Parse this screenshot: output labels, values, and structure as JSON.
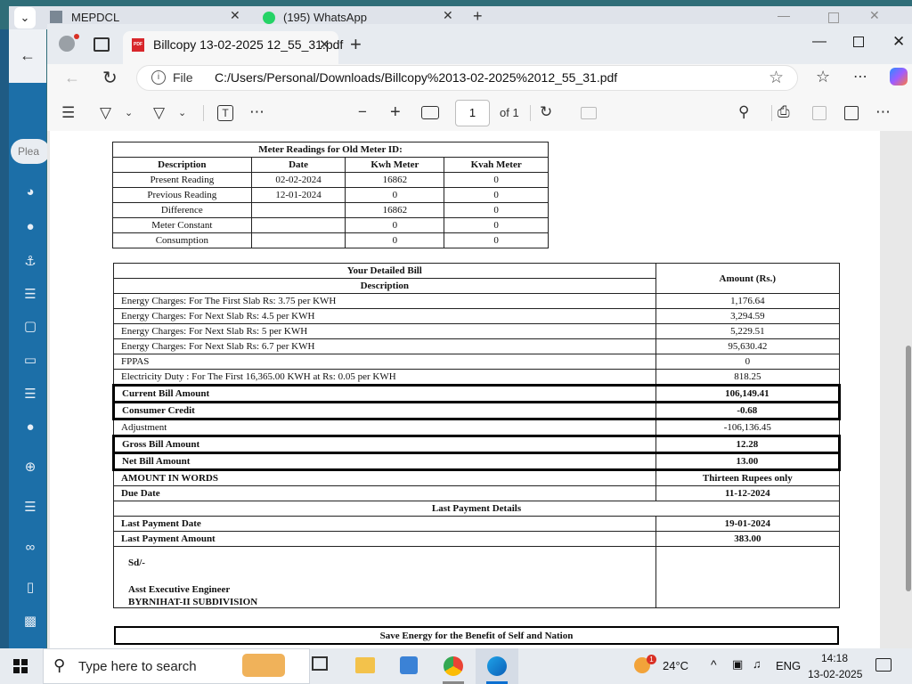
{
  "bg_browser": {
    "tab1": "MEPDCL",
    "tab2": "(195) WhatsApp",
    "search_pill": "Plea"
  },
  "browser": {
    "tab_title": "Billcopy 13-02-2025 12_55_31.pdf",
    "file_label": "File",
    "url": "C:/Users/Personal/Downloads/Billcopy%2013-02-2025%2012_55_31.pdf"
  },
  "pdf_toolbar": {
    "page_value": "1",
    "page_of": "of 1"
  },
  "meter_table": {
    "title": "Meter Readings for Old Meter ID:",
    "headers": [
      "Description",
      "Date",
      "Kwh Meter",
      "Kvah Meter"
    ],
    "rows": [
      [
        "Present Reading",
        "02-02-2024",
        "16862",
        "0"
      ],
      [
        "Previous Reading",
        "12-01-2024",
        "0",
        "0"
      ],
      [
        "Difference",
        "",
        "16862",
        "0"
      ],
      [
        "Meter Constant",
        "",
        "0",
        "0"
      ],
      [
        "Consumption",
        "",
        "0",
        "0"
      ]
    ]
  },
  "bill": {
    "title": "Your Detailed Bill",
    "desc_header": "Description",
    "amount_header": "Amount (Rs.)",
    "rows": [
      {
        "d": "Energy Charges: For The First Slab Rs: 3.75 per KWH",
        "a": "1,176.64"
      },
      {
        "d": "Energy Charges: For Next Slab Rs: 4.5 per KWH",
        "a": "3,294.59"
      },
      {
        "d": "Energy Charges: For Next Slab Rs: 5 per KWH",
        "a": "5,229.51"
      },
      {
        "d": "Energy Charges: For Next Slab Rs: 6.7 per KWH",
        "a": "95,630.42"
      },
      {
        "d": "FPPAS",
        "a": "0"
      },
      {
        "d": "Electricity Duty : For The First 16,365.00 KWH at Rs: 0.05 per KWH",
        "a": "818.25"
      },
      {
        "d": "Current Bill Amount",
        "a": "106,149.41"
      },
      {
        "d": "Consumer Credit",
        "a": "-0.68"
      },
      {
        "d": "Adjustment",
        "a": "-106,136.45"
      },
      {
        "d": "Gross Bill Amount",
        "a": "12.28"
      },
      {
        "d": "Net Bill Amount",
        "a": "13.00"
      },
      {
        "d": "AMOUNT IN WORDS",
        "a": "Thirteen Rupees only"
      },
      {
        "d": "Due Date",
        "a": "11-12-2024"
      }
    ],
    "last_payment_title": "Last Payment Details",
    "last_payment": [
      {
        "d": "Last Payment Date",
        "a": "19-01-2024"
      },
      {
        "d": "Last Payment Amount",
        "a": "383.00"
      }
    ],
    "sig_sd": "Sd/-",
    "sig_title": "Asst Executive Engineer",
    "sig_office": "BYRNIHAT-II SUBDIVISION",
    "footer": "Save Energy for the Benefit of Self and Nation"
  },
  "taskbar": {
    "search_placeholder": "Type here to search",
    "weather": "24°C",
    "weather_badge": "1",
    "language": "ENG",
    "time": "14:18",
    "date": "13-02-2025"
  }
}
